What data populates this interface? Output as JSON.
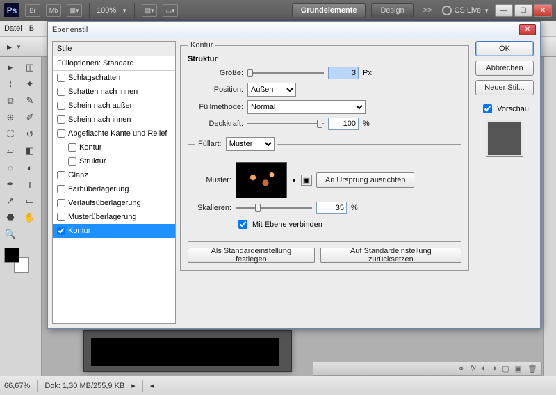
{
  "app": {
    "zoom_toolbar": "100%",
    "tabs": {
      "t1": "Grundelemente",
      "t2": "Design",
      "more": ">>"
    },
    "cslive": "CS Live",
    "menu": {
      "file": "Datei",
      "edit": "B"
    }
  },
  "dialog": {
    "title": "Ebenenstil",
    "styles_header": "Stile",
    "blend_header": "Fülloptionen: Standard",
    "items": [
      {
        "label": "Schlagschatten",
        "checked": false
      },
      {
        "label": "Schatten nach innen",
        "checked": false
      },
      {
        "label": "Schein nach außen",
        "checked": false
      },
      {
        "label": "Schein nach innen",
        "checked": false
      },
      {
        "label": "Abgeflachte Kante und Relief",
        "checked": false
      },
      {
        "label": "Kontur",
        "checked": false,
        "sub": true
      },
      {
        "label": "Struktur",
        "checked": false,
        "sub": true
      },
      {
        "label": "Glanz",
        "checked": false
      },
      {
        "label": "Farbüberlagerung",
        "checked": false
      },
      {
        "label": "Verlaufsüberlagerung",
        "checked": false
      },
      {
        "label": "Musterüberlagerung",
        "checked": false
      },
      {
        "label": "Kontur",
        "checked": true,
        "selected": true
      }
    ],
    "kontur_legend": "Kontur",
    "struktur_legend": "Struktur",
    "labels": {
      "size": "Größe:",
      "position": "Position:",
      "fillmethod": "Füllmethode:",
      "opacity": "Deckkraft:",
      "filltype": "Füllart:",
      "pattern": "Muster:",
      "scale": "Skalieren:",
      "link": "Mit Ebene verbinden",
      "px": "Px",
      "pct": "%"
    },
    "values": {
      "size": "3",
      "position": "Außen",
      "fillmethod": "Normal",
      "opacity": "100",
      "filltype": "Muster",
      "scale": "35",
      "link": true
    },
    "buttons": {
      "snap": "An Ursprung ausrichten",
      "make_default": "Als Standardeinstellung festlegen",
      "reset_default": "Auf Standardeinstellung zurücksetzen",
      "ok": "OK",
      "cancel": "Abbrechen",
      "new_style": "Neuer Stil...",
      "preview": "Vorschau"
    }
  },
  "status": {
    "zoom": "66,67%",
    "doc": "Dok: 1,30 MB/255,9 KB"
  }
}
